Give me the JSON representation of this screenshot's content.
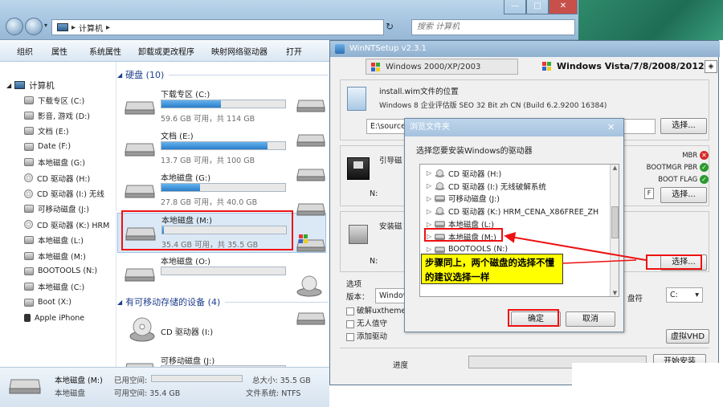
{
  "explorer": {
    "breadcrumb": "计算机",
    "search_placeholder": "搜索 计算机",
    "toolbar": [
      "组织",
      "属性",
      "系统属性",
      "卸载或更改程序",
      "映射网络驱动器",
      "打开"
    ],
    "sidebar_header": "计算机",
    "sidebar_items": [
      {
        "label": "下载专区 (C:)",
        "icon": "drive"
      },
      {
        "label": "影音, 游戏 (D:)",
        "icon": "drive"
      },
      {
        "label": "文档 (E:)",
        "icon": "drive"
      },
      {
        "label": "Date (F:)",
        "icon": "drive"
      },
      {
        "label": "本地磁盘 (G:)",
        "icon": "drive"
      },
      {
        "label": "CD 驱动器 (H:)",
        "icon": "cd"
      },
      {
        "label": "CD 驱动器 (I:) 无线",
        "icon": "cd"
      },
      {
        "label": "可移动磁盘 (J:)",
        "icon": "drive"
      },
      {
        "label": "CD 驱动器 (K:) HRM",
        "icon": "cd"
      },
      {
        "label": "本地磁盘 (L:)",
        "icon": "drive"
      },
      {
        "label": "本地磁盘 (M:)",
        "icon": "drive"
      },
      {
        "label": "BOOTOOLS (N:)",
        "icon": "drive"
      },
      {
        "label": "本地磁盘 (C:)",
        "icon": "drive"
      },
      {
        "label": "Boot (X:)",
        "icon": "drive"
      },
      {
        "label": "Apple iPhone",
        "icon": "phone"
      }
    ],
    "hdd_section": "硬盘 (10)",
    "drives": [
      {
        "name": "下载专区 (C:)",
        "capacity": "59.6 GB 可用，共 114 GB",
        "fill": 0.48
      },
      {
        "name": "文档 (E:)",
        "capacity": "13.7 GB 可用，共 100 GB",
        "fill": 0.86
      },
      {
        "name": "本地磁盘 (G:)",
        "capacity": "27.8 GB 可用，共 40.0 GB",
        "fill": 0.31
      },
      {
        "name": "本地磁盘 (M:)",
        "capacity": "35.4 GB 可用，共 35.5 GB",
        "fill": 0.01
      },
      {
        "name": "本地磁盘 (O:)",
        "capacity": "",
        "fill": 0.0
      }
    ],
    "removable_section": "有可移动存储的设备 (4)",
    "removable": [
      {
        "name": "CD 驱动器 (I:)"
      },
      {
        "name": "可移动磁盘 (J:)"
      }
    ],
    "status": {
      "name": "本地磁盘 (M:)",
      "type": "本地磁盘",
      "used_label": "已用空间:",
      "free": "可用空间: 35.4 GB",
      "total": "总大小: 35.5 GB",
      "fs": "文件系统: NTFS"
    }
  },
  "setup": {
    "title": "WinNTSetup v2.3.1",
    "tab_legacy": "Windows 2000/XP/2003",
    "tab_active": "Windows Vista/7/8/2008/2012",
    "install_location_title": "install.wim文件的位置",
    "image_info": "Windows 8 企业评估版 SEO 32 Bit zh CN (Build 6.2.9200 16384)",
    "source_path": "E:\\source...",
    "select_btn": "选择...",
    "boot_group": "引导磁",
    "boot_path": "N:",
    "flags": [
      {
        "label": "MBR",
        "status": "error"
      },
      {
        "label": "BOOTMGR PBR",
        "status": "ok"
      },
      {
        "label": "BOOT FLAG",
        "status": "ok"
      }
    ],
    "install_group": "安装磁",
    "install_path": "N:",
    "options_label": "选项",
    "version_label": "版本：",
    "version_value": "Windows",
    "checkboxes": [
      "破解uxtheme",
      "无人值守",
      "添加驱动"
    ],
    "drive_label": "盘符",
    "drive_value": "C:",
    "vhd_btn": "虚拟VHD",
    "progress_label": "进度",
    "start_btn": "开始安装"
  },
  "dialog": {
    "title": "浏览文件夹",
    "prompt": "选择您要安装Windows的驱动器",
    "tree": [
      {
        "label": "CD 驱动器 (H:)",
        "icon": "cd"
      },
      {
        "label": "CD 驱动器 (I:) 无线破解系统",
        "icon": "cd"
      },
      {
        "label": "可移动磁盘 (J:)",
        "icon": "drive"
      },
      {
        "label": "CD 驱动器 (K:) HRM_CENA_X86FREE_ZH",
        "icon": "cd"
      },
      {
        "label": "本地磁盘 (L:)",
        "icon": "drive"
      },
      {
        "label": "本地磁盘 (M:)",
        "icon": "drive"
      },
      {
        "label": "BOOTOOLS (N:)",
        "icon": "drive"
      }
    ],
    "ok_btn": "确定",
    "cancel_btn": "取消"
  },
  "annotation": {
    "text": "步骤同上，两个磁盘的选择不懂的建议选择一样"
  },
  "colors": {
    "highlight_red": "#e11111",
    "callout_yellow": "#ffff00",
    "bar_blue": "#2a7dc8"
  }
}
